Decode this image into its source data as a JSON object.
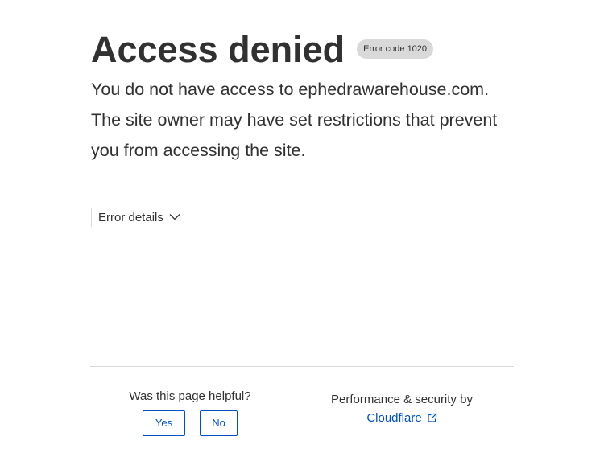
{
  "page": {
    "title": "Access denied",
    "error_code": "Error code 1020",
    "message": "You do not have access to ephedrawarehouse.com. The site owner may have set restrictions that prevent you from accessing the site."
  },
  "details": {
    "label": "Error details",
    "icon": "chevron-down-icon"
  },
  "feedback": {
    "question": "Was this page helpful?",
    "yes_label": "Yes",
    "no_label": "No"
  },
  "footer": {
    "performance_text": "Performance & security by",
    "provider_label": "Cloudflare",
    "provider_icon": "external-link-icon"
  },
  "colors": {
    "text": "#313131",
    "link": "#0051c3",
    "badge_bg": "#d9d9d9",
    "divider": "#d9d9d9"
  }
}
